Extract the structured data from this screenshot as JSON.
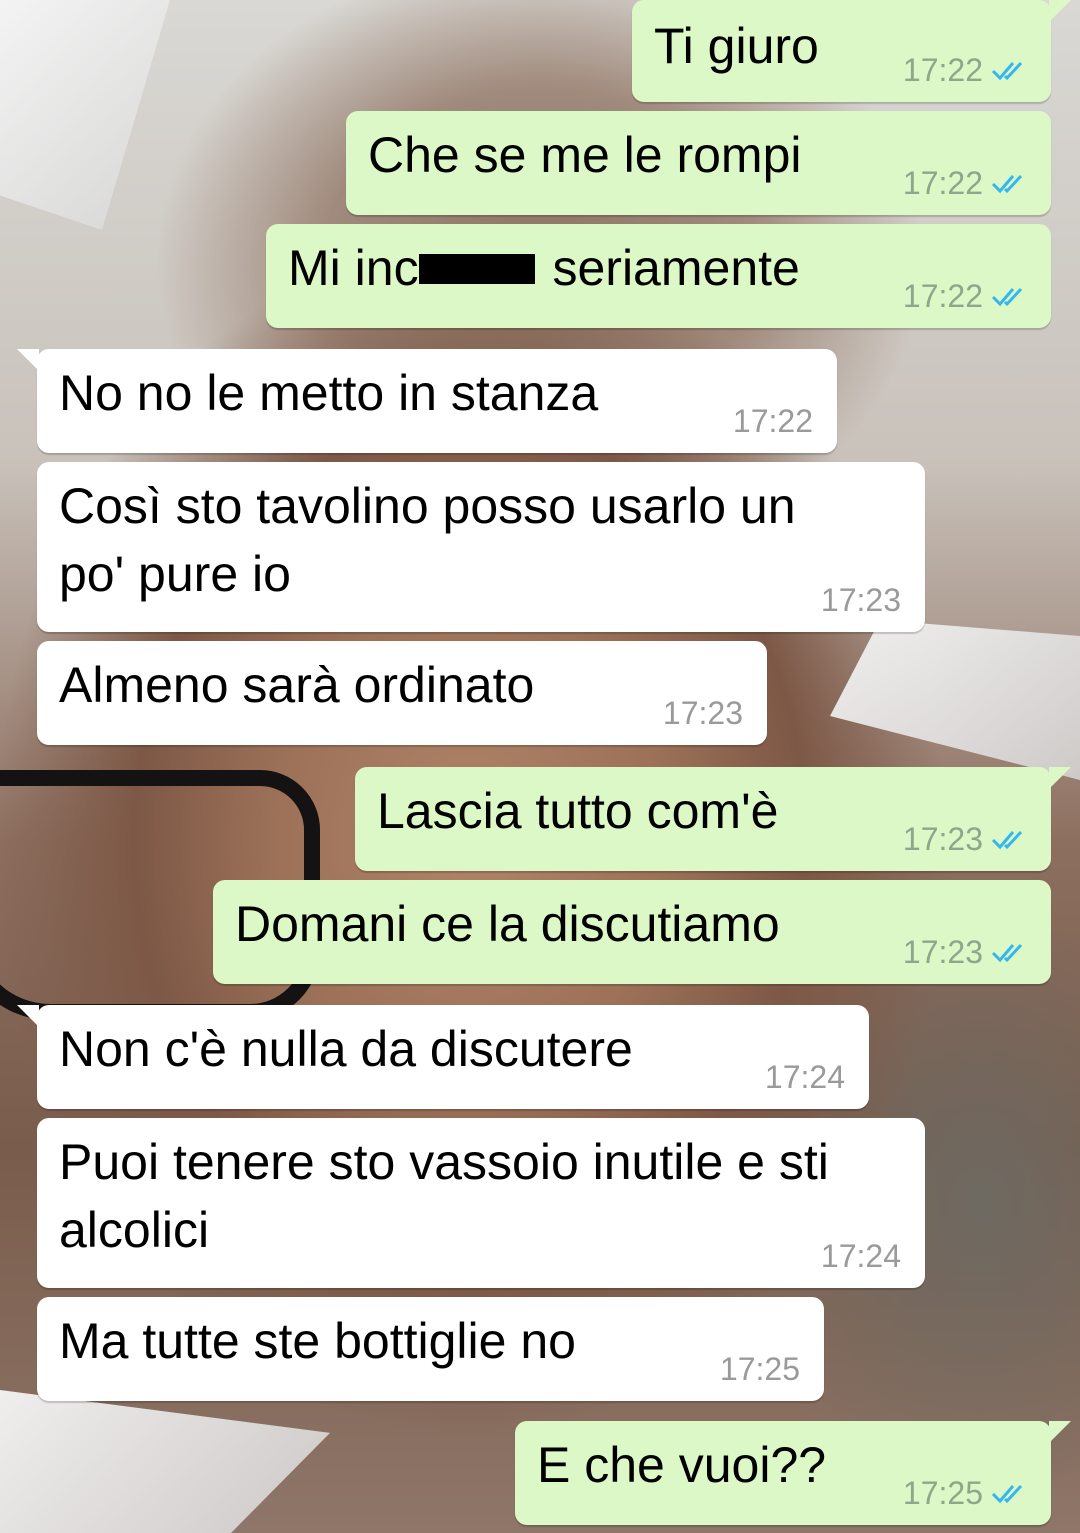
{
  "colors": {
    "outgoing_bubble": "#dcf8c6",
    "incoming_bubble": "#ffffff",
    "read_ticks": "#34b7f1",
    "timestamp": "#9a9a9a"
  },
  "messages": [
    {
      "id": "m1",
      "direction": "out",
      "text": "Ti giuro",
      "time": "17:22",
      "status": "read"
    },
    {
      "id": "m2",
      "direction": "out",
      "text": "Che se me le rompi",
      "time": "17:22",
      "status": "read"
    },
    {
      "id": "m3",
      "direction": "out",
      "text_before": "Mi inc",
      "text_after": "seriamente",
      "redacted": true,
      "time": "17:22",
      "status": "read"
    },
    {
      "id": "m4",
      "direction": "in",
      "text": "No no le metto in stanza",
      "time": "17:22"
    },
    {
      "id": "m5",
      "direction": "in",
      "text_line1": "Così sto tavolino posso usarlo un",
      "text_line2": "po' pure io",
      "time": "17:23"
    },
    {
      "id": "m6",
      "direction": "in",
      "text": "Almeno sarà ordinato",
      "time": "17:23"
    },
    {
      "id": "m7",
      "direction": "out",
      "text": "Lascia tutto com'è",
      "time": "17:23",
      "status": "read"
    },
    {
      "id": "m8",
      "direction": "out",
      "text": "Domani ce la discutiamo",
      "time": "17:23",
      "status": "read"
    },
    {
      "id": "m9",
      "direction": "in",
      "text": "Non c'è nulla da discutere",
      "time": "17:24"
    },
    {
      "id": "m10",
      "direction": "in",
      "text_line1": "Puoi tenere sto vassoio inutile e sti",
      "text_line2": "alcolici",
      "time": "17:24"
    },
    {
      "id": "m11",
      "direction": "in",
      "text": "Ma tutte ste bottiglie no",
      "time": "17:25"
    },
    {
      "id": "m12",
      "direction": "out",
      "text": "E che vuoi??",
      "time": "17:25",
      "status": "read"
    }
  ]
}
